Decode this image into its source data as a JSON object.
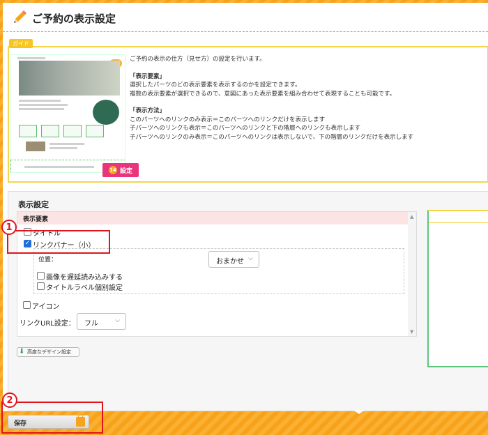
{
  "page": {
    "title": "ご予約の表示設定"
  },
  "guide": {
    "tag": "ガイド",
    "set_button_number": "14",
    "set_button_label": "設定",
    "paragraphs": {
      "intro": "ご予約の表示の仕方（見せ方）の設定を行います。",
      "elements_head": "「表示要素」",
      "elements_1": "選択したパーツのどの表示要素を表示するのかを設定できます。",
      "elements_2": "複数の表示要素が選択できるので、意図にあった表示要素を組み合わせて表現することも可能です。",
      "method_head": "「表示方法」",
      "method_1": "このパーツへのリンクのみ表示＝このパーツへのリンクだけを表示します",
      "method_2": "子パーツへのリンクも表示＝このパーツへのリンクと下の階層へのリンクも表示します",
      "method_3": "子パーツへのリンクのみ表示＝このパーツへのリンクは表示しないで、下の階層のリンクだけを表示します"
    }
  },
  "settings": {
    "title": "表示設定",
    "list_header": "表示要素",
    "items": {
      "title_label": "タイトル",
      "link_banner_label": "リンクバナー（小）",
      "position_label": "位置：",
      "position_value": "おまかせ",
      "lazy_load_label": "画像を遅延読み込みする",
      "title_label_individual": "タイトルラベル個別設定",
      "icon_label": "アイコン",
      "link_url_label": "リンクURL設定：",
      "link_url_value": "フル"
    },
    "advanced_button": "高度なデザイン設定"
  },
  "footer": {
    "save_label": "保存"
  },
  "callouts": {
    "one": "1",
    "two": "2"
  },
  "colors": {
    "accent_orange": "#f8a21a",
    "guide_border": "#f5d64a",
    "list_header_bg": "#fde4e4",
    "callout_red": "#e1141e",
    "checkbox_blue": "#1f6fd8",
    "setting_button": "#e9357b"
  }
}
